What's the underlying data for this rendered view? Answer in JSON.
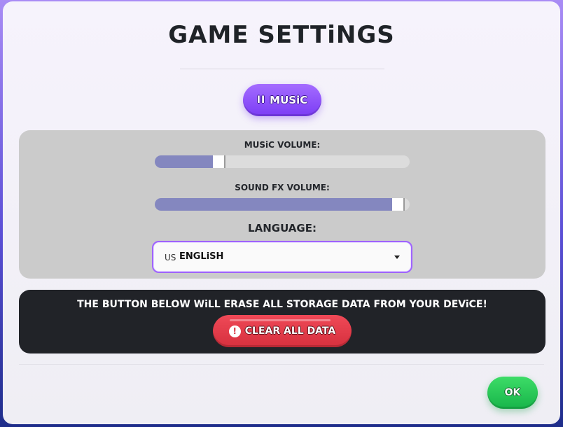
{
  "dialog": {
    "title": "GAME SETTiNGS"
  },
  "music_toggle": {
    "icon": "pause-icon",
    "icon_glyph": "II",
    "label": "MUSiC"
  },
  "settings": {
    "music_volume_label": "MUSiC VOLUME:",
    "music_volume": 0.24,
    "sfx_volume_label": "SOUND FX VOLUME:",
    "sfx_volume": 0.98,
    "language_label": "LANGUAGE:",
    "language": {
      "flag": "US",
      "selected": "ENGLiSH"
    }
  },
  "danger_zone": {
    "warning": "THE BUTTON BELOW WiLL ERASE ALL STORAGE DATA FROM YOUR DEViCE!",
    "clear_icon": "alert-icon",
    "clear_icon_glyph": "!",
    "clear_label": "CLEAR ALL DATA"
  },
  "footer": {
    "ok_label": "OK"
  },
  "colors": {
    "accent_purple": "#7b3cf5",
    "slider_fill": "#8487bf",
    "danger_red": "#d6303e",
    "ok_green": "#17b54a"
  }
}
